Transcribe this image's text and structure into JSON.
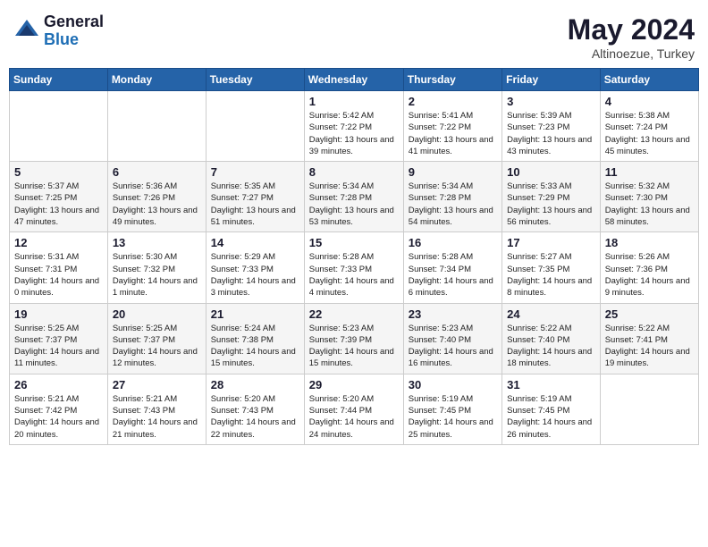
{
  "header": {
    "logo_general": "General",
    "logo_blue": "Blue",
    "month_year": "May 2024",
    "location": "Altinoezue, Turkey"
  },
  "weekdays": [
    "Sunday",
    "Monday",
    "Tuesday",
    "Wednesday",
    "Thursday",
    "Friday",
    "Saturday"
  ],
  "weeks": [
    [
      {
        "day": "",
        "content": ""
      },
      {
        "day": "",
        "content": ""
      },
      {
        "day": "",
        "content": ""
      },
      {
        "day": "1",
        "content": "Sunrise: 5:42 AM\nSunset: 7:22 PM\nDaylight: 13 hours and 39 minutes."
      },
      {
        "day": "2",
        "content": "Sunrise: 5:41 AM\nSunset: 7:22 PM\nDaylight: 13 hours and 41 minutes."
      },
      {
        "day": "3",
        "content": "Sunrise: 5:39 AM\nSunset: 7:23 PM\nDaylight: 13 hours and 43 minutes."
      },
      {
        "day": "4",
        "content": "Sunrise: 5:38 AM\nSunset: 7:24 PM\nDaylight: 13 hours and 45 minutes."
      }
    ],
    [
      {
        "day": "5",
        "content": "Sunrise: 5:37 AM\nSunset: 7:25 PM\nDaylight: 13 hours and 47 minutes."
      },
      {
        "day": "6",
        "content": "Sunrise: 5:36 AM\nSunset: 7:26 PM\nDaylight: 13 hours and 49 minutes."
      },
      {
        "day": "7",
        "content": "Sunrise: 5:35 AM\nSunset: 7:27 PM\nDaylight: 13 hours and 51 minutes."
      },
      {
        "day": "8",
        "content": "Sunrise: 5:34 AM\nSunset: 7:28 PM\nDaylight: 13 hours and 53 minutes."
      },
      {
        "day": "9",
        "content": "Sunrise: 5:34 AM\nSunset: 7:28 PM\nDaylight: 13 hours and 54 minutes."
      },
      {
        "day": "10",
        "content": "Sunrise: 5:33 AM\nSunset: 7:29 PM\nDaylight: 13 hours and 56 minutes."
      },
      {
        "day": "11",
        "content": "Sunrise: 5:32 AM\nSunset: 7:30 PM\nDaylight: 13 hours and 58 minutes."
      }
    ],
    [
      {
        "day": "12",
        "content": "Sunrise: 5:31 AM\nSunset: 7:31 PM\nDaylight: 14 hours and 0 minutes."
      },
      {
        "day": "13",
        "content": "Sunrise: 5:30 AM\nSunset: 7:32 PM\nDaylight: 14 hours and 1 minute."
      },
      {
        "day": "14",
        "content": "Sunrise: 5:29 AM\nSunset: 7:33 PM\nDaylight: 14 hours and 3 minutes."
      },
      {
        "day": "15",
        "content": "Sunrise: 5:28 AM\nSunset: 7:33 PM\nDaylight: 14 hours and 4 minutes."
      },
      {
        "day": "16",
        "content": "Sunrise: 5:28 AM\nSunset: 7:34 PM\nDaylight: 14 hours and 6 minutes."
      },
      {
        "day": "17",
        "content": "Sunrise: 5:27 AM\nSunset: 7:35 PM\nDaylight: 14 hours and 8 minutes."
      },
      {
        "day": "18",
        "content": "Sunrise: 5:26 AM\nSunset: 7:36 PM\nDaylight: 14 hours and 9 minutes."
      }
    ],
    [
      {
        "day": "19",
        "content": "Sunrise: 5:25 AM\nSunset: 7:37 PM\nDaylight: 14 hours and 11 minutes."
      },
      {
        "day": "20",
        "content": "Sunrise: 5:25 AM\nSunset: 7:37 PM\nDaylight: 14 hours and 12 minutes."
      },
      {
        "day": "21",
        "content": "Sunrise: 5:24 AM\nSunset: 7:38 PM\nDaylight: 14 hours and 15 minutes."
      },
      {
        "day": "22",
        "content": "Sunrise: 5:23 AM\nSunset: 7:39 PM\nDaylight: 14 hours and 15 minutes."
      },
      {
        "day": "23",
        "content": "Sunrise: 5:23 AM\nSunset: 7:40 PM\nDaylight: 14 hours and 16 minutes."
      },
      {
        "day": "24",
        "content": "Sunrise: 5:22 AM\nSunset: 7:40 PM\nDaylight: 14 hours and 18 minutes."
      },
      {
        "day": "25",
        "content": "Sunrise: 5:22 AM\nSunset: 7:41 PM\nDaylight: 14 hours and 19 minutes."
      }
    ],
    [
      {
        "day": "26",
        "content": "Sunrise: 5:21 AM\nSunset: 7:42 PM\nDaylight: 14 hours and 20 minutes."
      },
      {
        "day": "27",
        "content": "Sunrise: 5:21 AM\nSunset: 7:43 PM\nDaylight: 14 hours and 21 minutes."
      },
      {
        "day": "28",
        "content": "Sunrise: 5:20 AM\nSunset: 7:43 PM\nDaylight: 14 hours and 22 minutes."
      },
      {
        "day": "29",
        "content": "Sunrise: 5:20 AM\nSunset: 7:44 PM\nDaylight: 14 hours and 24 minutes."
      },
      {
        "day": "30",
        "content": "Sunrise: 5:19 AM\nSunset: 7:45 PM\nDaylight: 14 hours and 25 minutes."
      },
      {
        "day": "31",
        "content": "Sunrise: 5:19 AM\nSunset: 7:45 PM\nDaylight: 14 hours and 26 minutes."
      },
      {
        "day": "",
        "content": ""
      }
    ]
  ]
}
